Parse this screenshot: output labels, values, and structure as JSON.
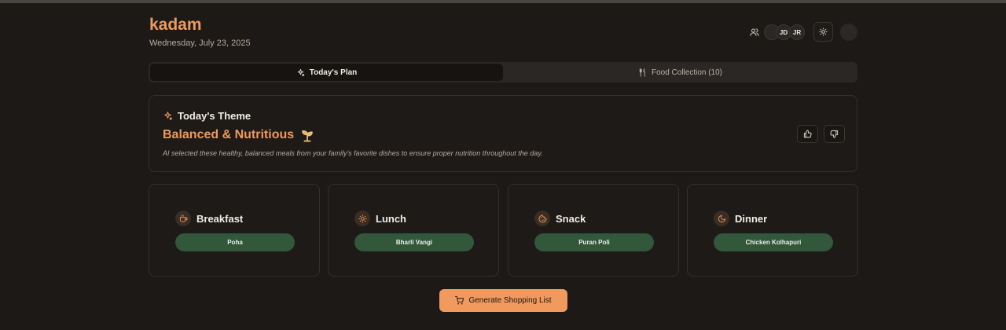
{
  "header": {
    "title": "kadam",
    "date": "Wednesday, July 23, 2025",
    "members_icon": "users-icon",
    "avatars": [
      {
        "initials": ""
      },
      {
        "initials": "JD"
      },
      {
        "initials": "JR"
      }
    ],
    "theme_toggle_icon": "sun-icon",
    "profile_avatar": ""
  },
  "tabs": [
    {
      "label": "Today's Plan",
      "icon": "sparkles-icon",
      "active": true
    },
    {
      "label": "Food Collection (10)",
      "icon": "utensils-icon",
      "active": false
    }
  ],
  "theme_card": {
    "label": "Today's Theme",
    "label_icon": "sparkles-icon",
    "title": "Balanced & Nutritious",
    "title_icon": "sprout-icon",
    "description": "AI selected these healthy, balanced meals from your family's favorite dishes to ensure proper nutrition throughout the day.",
    "like_icon": "thumbs-up-icon",
    "dislike_icon": "thumbs-down-icon"
  },
  "meals": [
    {
      "name": "Breakfast",
      "icon": "coffee-icon",
      "dish": "Poha"
    },
    {
      "name": "Lunch",
      "icon": "sun-icon",
      "dish": "Bharli Vangi"
    },
    {
      "name": "Snack",
      "icon": "cookie-icon",
      "dish": "Puran Poli"
    },
    {
      "name": "Dinner",
      "icon": "moon-icon",
      "dish": "Chicken Kolhapuri"
    }
  ],
  "actions": {
    "shopping_label": "Generate Shopping List",
    "shopping_icon": "cart-icon"
  },
  "colors": {
    "accent": "#ee9a5e",
    "background": "#1c1916",
    "dish_pill": "#33573a",
    "button": "#f09a5e"
  }
}
